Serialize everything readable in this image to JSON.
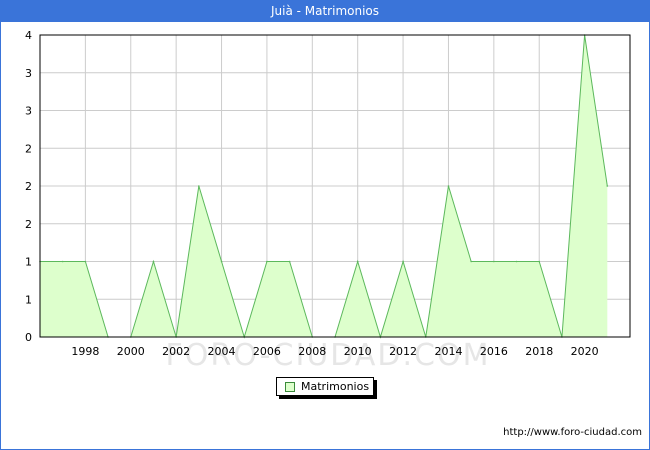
{
  "header": {
    "title": "Juià - Matrimonios"
  },
  "footer": {
    "url": "http://www.foro-ciudad.com"
  },
  "watermark": "FORO-CIUDAD.COM",
  "colors": {
    "titlebar": "#3a74d9",
    "area_fill": "#ddffcc",
    "area_line": "#5cb85c",
    "grid": "#cccccc"
  },
  "chart_data": {
    "type": "area",
    "title": "Juià - Matrimonios",
    "xlabel": "",
    "ylabel": "",
    "x": [
      1996,
      1997,
      1998,
      1999,
      2000,
      2001,
      2002,
      2003,
      2004,
      2005,
      2006,
      2007,
      2008,
      2009,
      2010,
      2011,
      2012,
      2013,
      2014,
      2015,
      2016,
      2017,
      2018,
      2019,
      2020,
      2021
    ],
    "series": [
      {
        "name": "Matrimonios",
        "values": [
          1,
          1,
          1,
          0,
          0,
          1,
          0,
          2,
          1,
          0,
          1,
          1,
          0,
          0,
          1,
          0,
          1,
          0,
          2,
          1,
          1,
          1,
          1,
          0,
          4,
          2
        ]
      }
    ],
    "xlim": [
      1996,
      2022
    ],
    "ylim": [
      0,
      4
    ],
    "x_ticks": [
      1998,
      2000,
      2002,
      2004,
      2006,
      2008,
      2010,
      2012,
      2014,
      2016,
      2018,
      2020
    ],
    "y_ticks": [
      0,
      0.5,
      1,
      1.5,
      2,
      2.5,
      3,
      3.5,
      4
    ],
    "y_tick_labels": [
      "0",
      "1",
      "1",
      "2",
      "2",
      "2",
      "3",
      "3",
      "4"
    ],
    "grid": true,
    "legend": {
      "position": "bottom-center",
      "entries": [
        "Matrimonios"
      ]
    }
  }
}
